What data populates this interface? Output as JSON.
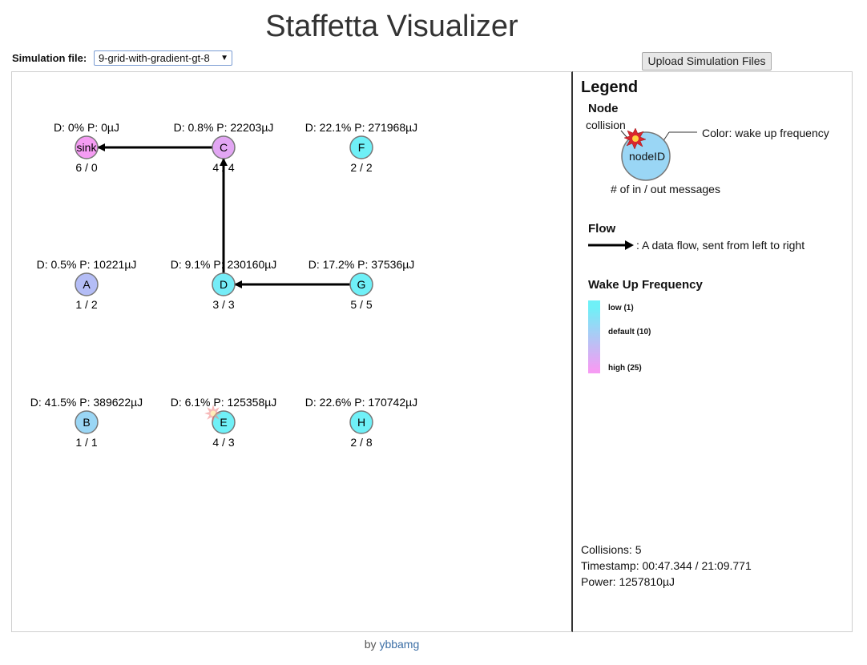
{
  "page": {
    "title": "Staffetta Visualizer",
    "simulation_label": "Simulation file:",
    "simulation_value": "9-grid-with-gradient-gt-8",
    "upload_button": "Upload Simulation Files",
    "footer_by": "by",
    "footer_author": "ybbamg"
  },
  "nodes": [
    {
      "id": "sink",
      "stats": "D: 0% P: 0µJ",
      "msgs": "6 / 0",
      "color": "#f59cf3"
    },
    {
      "id": "C",
      "stats": "D: 0.8% P: 22203µJ",
      "msgs": "4 / 4",
      "color": "#e2a6f3"
    },
    {
      "id": "F",
      "stats": "D: 22.1% P: 271968µJ",
      "msgs": "2 / 2",
      "color": "#6ff0f7"
    },
    {
      "id": "A",
      "stats": "D: 0.5% P: 10221µJ",
      "msgs": "1 / 2",
      "color": "#b4bdf6"
    },
    {
      "id": "D",
      "stats": "D: 9.1% P: 230160µJ",
      "msgs": "3 / 3",
      "color": "#75ecf7"
    },
    {
      "id": "G",
      "stats": "D: 17.2% P: 37536µJ",
      "msgs": "5 / 5",
      "color": "#6ff0f7"
    },
    {
      "id": "B",
      "stats": "D: 41.5% P: 389622µJ",
      "msgs": "1 / 1",
      "color": "#9ad6f5"
    },
    {
      "id": "E",
      "stats": "D: 6.1% P: 125358µJ",
      "msgs": "4 / 3",
      "color": "#6ff0f7",
      "collision": true
    },
    {
      "id": "H",
      "stats": "D: 22.6% P: 170742µJ",
      "msgs": "2 / 8",
      "color": "#6ff0f7"
    }
  ],
  "flows": [
    {
      "from": "C",
      "to": "sink"
    },
    {
      "from": "D",
      "to": "C"
    },
    {
      "from": "G",
      "to": "D"
    }
  ],
  "legend": {
    "title": "Legend",
    "node_heading": "Node",
    "collision_label": "collision",
    "color_label": "Color: wake up frequency",
    "node_id_label": "nodeID",
    "messages_label": "# of in / out messages",
    "flow_heading": "Flow",
    "flow_desc": ": A data flow, sent from left to right",
    "wake_heading": "Wake Up Frequency",
    "wake_low": "low (1)",
    "wake_default": "default (10)",
    "wake_high": "high (25)",
    "gradient_colors": [
      "#6ff0f7",
      "#f59cf3"
    ]
  },
  "stats": {
    "collisions": "Collisions: 5",
    "timestamp": "Timestamp: 00:47.344 / 21:09.771",
    "power": "Power: 1257810µJ"
  }
}
